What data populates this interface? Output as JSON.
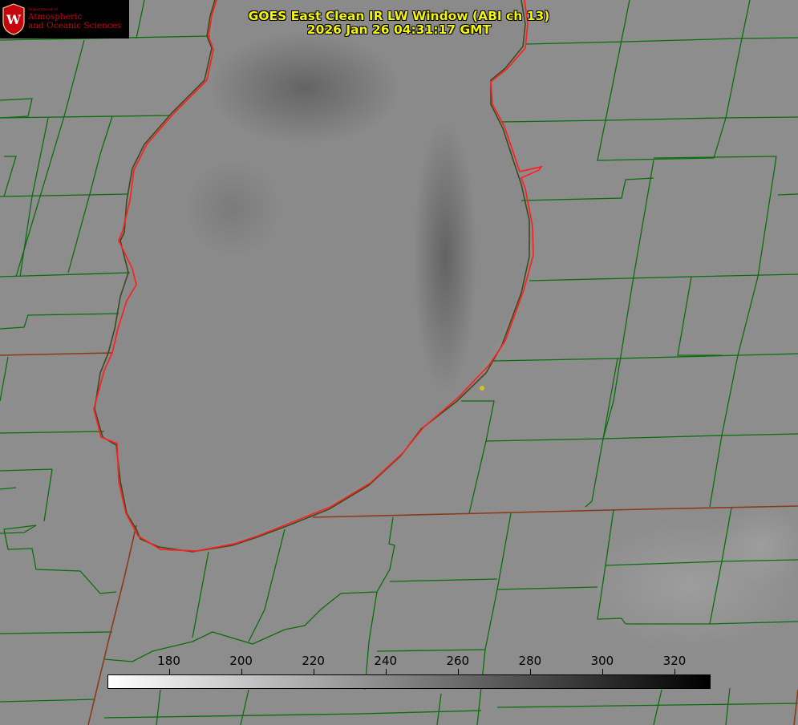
{
  "title": {
    "line1": "GOES East Clean IR LW Window (ABI ch 13)",
    "line2": "2026 Jan 26 04:31:17 GMT"
  },
  "logo": {
    "dept": "Department of",
    "line1": "Atmospheric",
    "line2": "and Oceanic Sciences",
    "seal_letter": "W"
  },
  "colorbar": {
    "ticks": [
      "180",
      "200",
      "220",
      "240",
      "260",
      "280",
      "300",
      "320"
    ],
    "min": 163,
    "max": 330,
    "colormap": "white-to-black"
  },
  "colors": {
    "background_gray": "#8d8d8d",
    "county_lines": "#0a6e0a",
    "state_lines": "#8b3a1a",
    "coastline": "#ff2020",
    "title_text": "#f5f500",
    "logo_red": "#c5050c",
    "marker": "#d8c020"
  }
}
